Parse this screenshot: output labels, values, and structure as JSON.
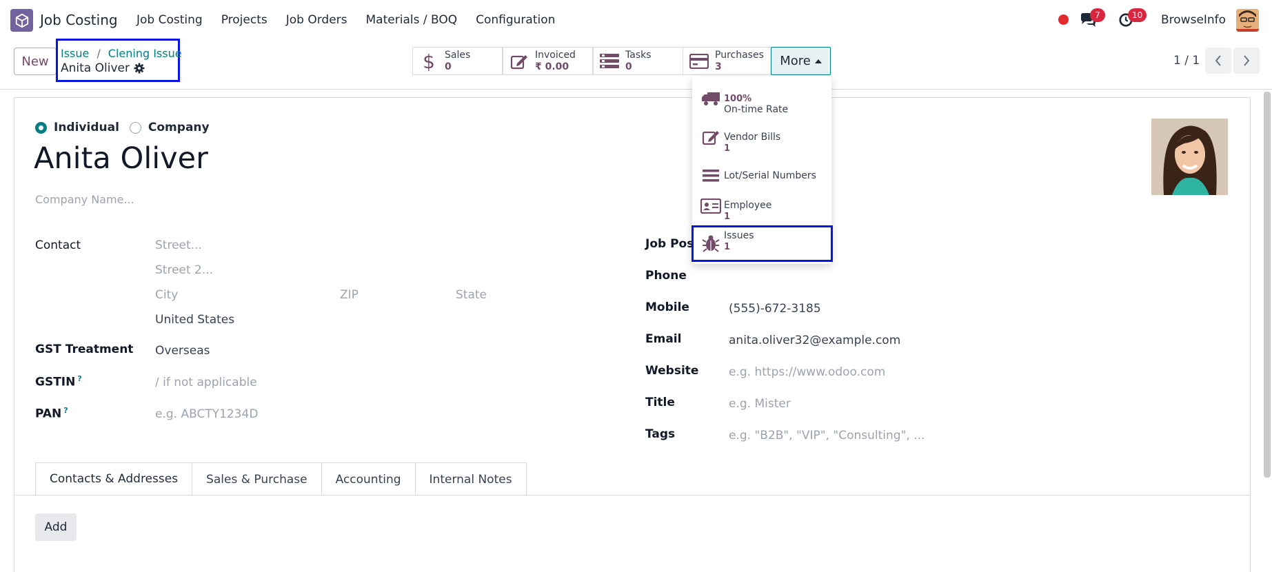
{
  "navbar": {
    "app_name": "Job Costing",
    "menu": [
      "Job Costing",
      "Projects",
      "Job Orders",
      "Materials / BOQ",
      "Configuration"
    ],
    "messages_count": "7",
    "activities_count": "10",
    "company": "BrowseInfo"
  },
  "control": {
    "new_label": "New",
    "breadcrumb": [
      "Issue",
      "Clening Issue"
    ],
    "record_name": "Anita Oliver",
    "smart_buttons": [
      {
        "label": "Sales",
        "value": "0",
        "icon": "dollar-icon"
      },
      {
        "label": "Invoiced",
        "value": "₹ 0.00",
        "icon": "pencil-square-icon"
      },
      {
        "label": "Tasks",
        "value": "0",
        "icon": "tasks-icon"
      },
      {
        "label": "Purchases",
        "value": "3",
        "icon": "credit-card-icon"
      }
    ],
    "more_label": "More",
    "pager": "1 / 1"
  },
  "dropdown": [
    {
      "label": "On-time Rate",
      "value": "100%",
      "icon": "truck-icon"
    },
    {
      "label": "Vendor Bills",
      "value": "1",
      "icon": "pencil-square-icon"
    },
    {
      "label": "Lot/Serial Numbers",
      "value": "",
      "icon": "bars-icon"
    },
    {
      "label": "Employee",
      "value": "1",
      "icon": "id-card-icon"
    },
    {
      "label": "Issues",
      "value": "1",
      "icon": "bug-icon"
    }
  ],
  "form": {
    "type_options": [
      "Individual",
      "Company"
    ],
    "name": "Anita Oliver",
    "company_placeholder": "Company Name...",
    "contact_label": "Contact",
    "street_ph": "Street...",
    "street2_ph": "Street 2...",
    "city_ph": "City",
    "zip_ph": "ZIP",
    "state_ph": "State",
    "country": "United States",
    "gst_label": "GST Treatment",
    "gst_value": "Overseas",
    "gstin_label": "GSTIN",
    "gstin_ph": "/ if not applicable",
    "pan_label": "PAN",
    "pan_ph": "e.g. ABCTY1234D",
    "help_mark": "?",
    "job_label": "Job Posi",
    "phone_label": "Phone",
    "mobile_label": "Mobile",
    "mobile_value": "(555)-672-3185",
    "email_label": "Email",
    "email_value": "anita.oliver32@example.com",
    "website_label": "Website",
    "website_ph": "e.g. https://www.odoo.com",
    "title_label": "Title",
    "title_ph": "e.g. Mister",
    "tags_label": "Tags",
    "tags_ph": "e.g. \"B2B\", \"VIP\", \"Consulting\", ..."
  },
  "tabs": [
    "Contacts & Addresses",
    "Sales & Purchase",
    "Accounting",
    "Internal Notes"
  ],
  "add_label": "Add",
  "colors": {
    "primary": "#714b67",
    "teal": "#017e84",
    "highlight": "#0a15e0"
  }
}
